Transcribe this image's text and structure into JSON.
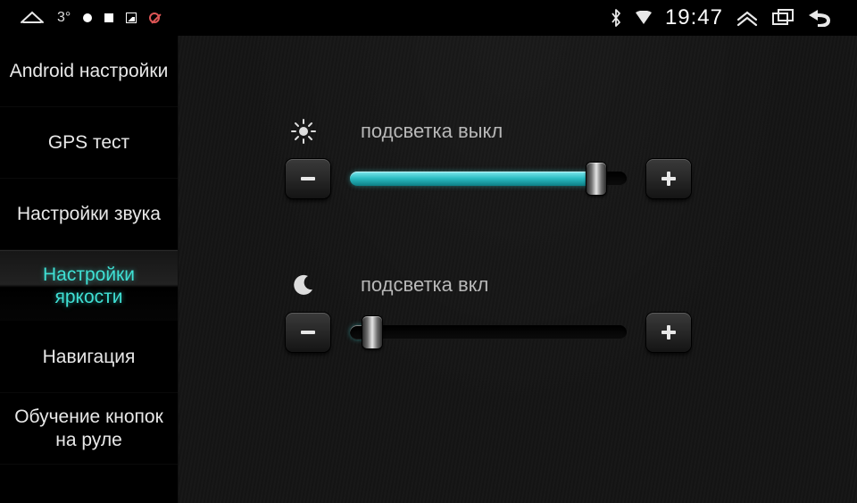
{
  "statusbar": {
    "temperature": "3°",
    "clock": "19:47"
  },
  "sidebar": {
    "items": [
      {
        "label": "Android настройки"
      },
      {
        "label": "GPS тест"
      },
      {
        "label": "Настройки звука"
      },
      {
        "label": "Настройки яркости",
        "active": true
      },
      {
        "label": "Навигация"
      },
      {
        "label": "Обучение кнопок на руле"
      }
    ]
  },
  "brightness": {
    "day": {
      "label": "подсветка выкл",
      "value": 92
    },
    "night": {
      "label": "подсветка вкл",
      "value": 5
    }
  }
}
